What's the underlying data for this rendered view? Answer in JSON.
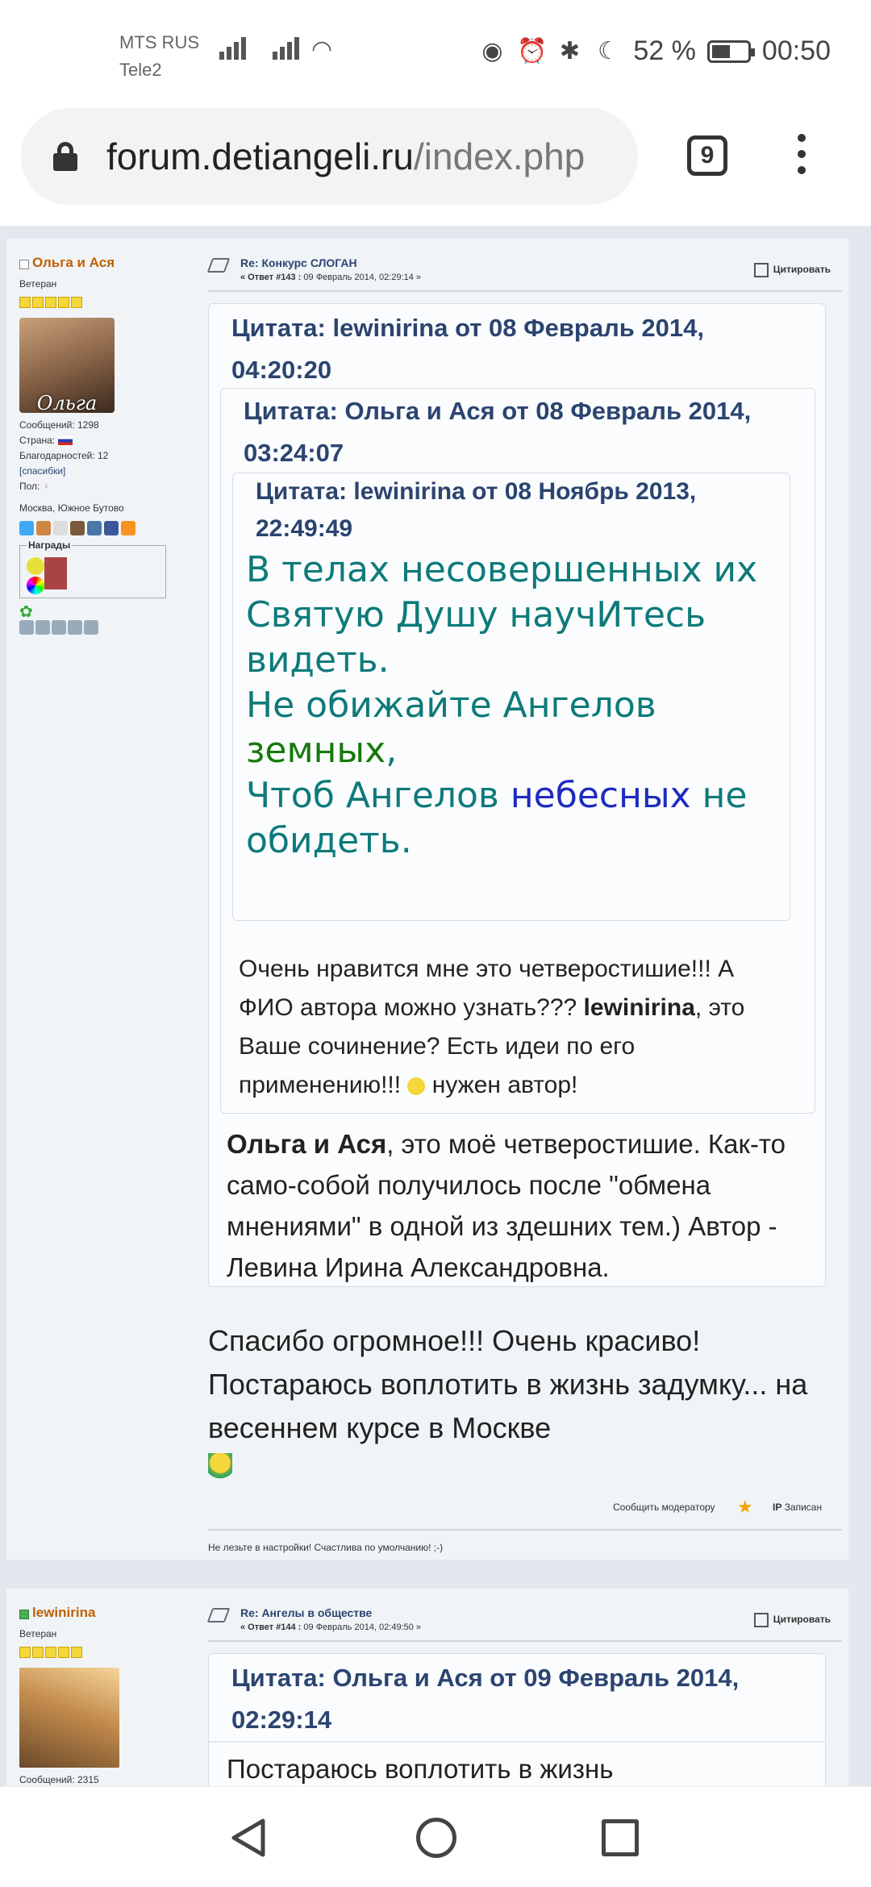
{
  "status": {
    "carrier1": "MTS RUS",
    "carrier2": "Tele2",
    "battery": "52 %",
    "battery_level": 0.52,
    "time": "00:50",
    "icons": [
      "eye-icon",
      "alarm-icon",
      "bluetooth-icon",
      "moon-icon",
      "battery-icon"
    ]
  },
  "browser": {
    "url_domain": "forum.detiangeli.ru",
    "url_path": "/index.php",
    "tab_count": "9"
  },
  "post1": {
    "author": "Ольга и Ася",
    "rank": "Ветеран",
    "avatar_caption": "Ольга",
    "messages": "Сообщений: 1298",
    "country": "Страна:",
    "thanks": "Благодарностей: 12",
    "thanks_link": "[спасибки]",
    "gender": "Пол:",
    "location": "Москва, Южное Бутово",
    "awards_label": "Награды",
    "title": "Re: Конкурс СЛОГАН",
    "meta_label": "« Ответ #143 :",
    "meta_date": "09 Февраль 2014, 02:29:14 »",
    "quote_button": "Цитировать",
    "q1_header": "Цитата: lewinirina от 08 Февраль 2014, 04:20:20",
    "q2_header": "Цитата: Ольга и Ася от 08 Февраль 2014, 03:24:07",
    "q3_header": "Цитата: lewinirina от 08 Ноябрь 2013, 22:49:49",
    "poem_l1": "В телах несовершенных их",
    "poem_l2": "Святую Душу научИтесь видеть.",
    "poem_l3": "Не обижайте Ангелов",
    "poem_l4": "земных",
    "poem_l4b": ",",
    "poem_l5a": "Чтоб Ангелов ",
    "poem_l5b": "небесных",
    "poem_l5c": " не обидеть.",
    "q2_text_a": "Очень нравится мне это четверостишие!!! А ФИО автора можно узнать??? ",
    "q2_text_b": "lewinirina",
    "q2_text_c": ", это Ваше сочинение? Есть идеи по его применению!!! ",
    "q2_text_d": " нужен автор!",
    "q1_text_a": "Ольга и Ася",
    "q1_text_b": ", это моё четверостишие. Как-то само-собой получилось после \"обмена мнениями\" в одной из здешних тем.) Автор - Левина Ирина Александровна.",
    "reply": "Спасибо огромное!!! Очень красиво! Постараюсь воплотить в жизнь задумку... на весеннем курсе в Москве",
    "report": "Сообщить модератору",
    "logged": "Записан",
    "signature": "Не лезьте в настройки! Счастлива по умолчанию! ;-)"
  },
  "post2": {
    "author": "lewinirina",
    "rank": "Ветеран",
    "messages": "Сообщений: 2315",
    "title": "Re: Ангелы в обществе",
    "meta_label": "« Ответ #144 :",
    "meta_date": "09 Февраль 2014, 02:49:50 »",
    "quote_button": "Цитировать",
    "q_header": "Цитата: Ольга и Ася от 09 Февраль 2014, 02:29:14",
    "q_text": "Постараюсь воплотить в жизнь"
  }
}
